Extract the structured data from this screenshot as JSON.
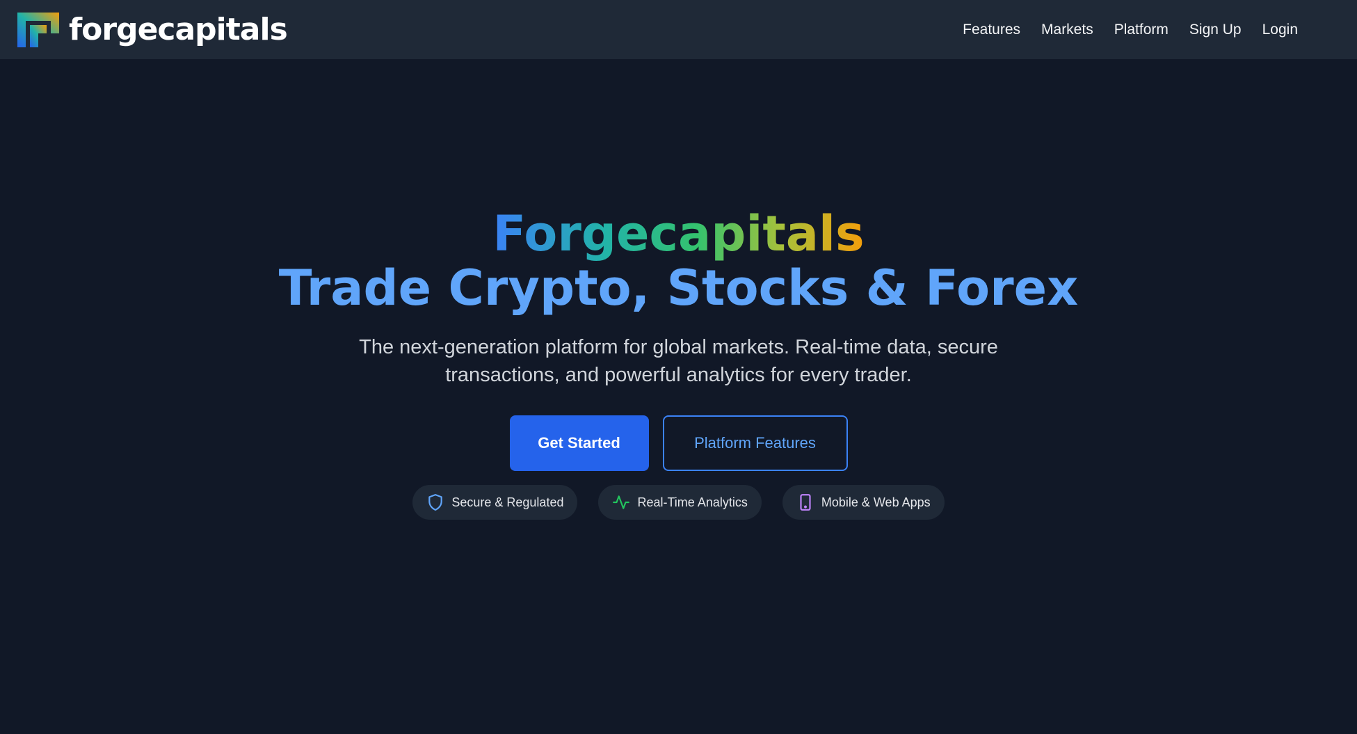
{
  "navbar": {
    "brand_name": "forgecapitals",
    "links": [
      "Features",
      "Markets",
      "Platform",
      "Sign Up",
      "Login"
    ]
  },
  "hero": {
    "brand_line": "Forgecapitals",
    "title": "Trade Crypto, Stocks & Forex",
    "subtitle": "The next-generation platform for global markets. Real-time data, secure transactions, and powerful analytics for every trader.",
    "primary_button": "Get Started",
    "secondary_button": "Platform Features",
    "badges": [
      {
        "label": "Secure & Regulated",
        "icon": "shield-icon",
        "color": "#60a5fa"
      },
      {
        "label": "Real-Time Analytics",
        "icon": "activity-icon",
        "color": "#22c55e"
      },
      {
        "label": "Mobile & Web Apps",
        "icon": "phone-icon",
        "color": "#c084fc"
      }
    ]
  },
  "colors": {
    "page_bg": "#111827",
    "navbar_bg": "#1f2937",
    "accent": "#2563eb",
    "title": "#60a5fa"
  }
}
